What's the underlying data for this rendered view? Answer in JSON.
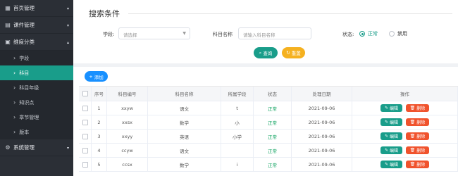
{
  "sidebar": {
    "groups": [
      {
        "label": "首页管理",
        "icon": "grid-icon",
        "caret": "▾"
      },
      {
        "label": "课件管理",
        "icon": "book-icon",
        "caret": "▾"
      },
      {
        "label": "维度分类",
        "icon": "doc-icon",
        "caret": "▴"
      },
      {
        "label": "系统管理",
        "icon": "gear-icon",
        "caret": "▾"
      }
    ],
    "sub_items": [
      {
        "label": "学段",
        "active": false
      },
      {
        "label": "科目",
        "active": true
      },
      {
        "label": "科目年级",
        "active": false
      },
      {
        "label": "知识点",
        "active": false
      },
      {
        "label": "章节管理",
        "active": false
      },
      {
        "label": "版本",
        "active": false
      }
    ]
  },
  "search": {
    "title": "搜索条件",
    "stage_label": "学段:",
    "stage_placeholder": "请选择",
    "subject_name_label": "科目名称",
    "subject_name_placeholder": "请输入科目名称",
    "status_label": "状态:",
    "status_normal": "正常",
    "status_disabled": "禁用",
    "query_button": "查询",
    "reset_button": "重置"
  },
  "toolbar": {
    "add_button": "添加"
  },
  "table": {
    "headers": [
      "序号",
      "科目编号",
      "科目名称",
      "所属学段",
      "状态",
      "处理日期",
      "操作"
    ],
    "rows": [
      {
        "index": "1",
        "code": "xxyw",
        "name": "语文",
        "stage": "t",
        "status": "正常",
        "date": "2021-09-06"
      },
      {
        "index": "2",
        "code": "xxsx",
        "name": "数学",
        "stage": "小",
        "status": "正常",
        "date": "2021-09-06"
      },
      {
        "index": "3",
        "code": "xxyy",
        "name": "英语",
        "stage": "小学",
        "status": "正常",
        "date": "2021-09-06"
      },
      {
        "index": "4",
        "code": "ccyw",
        "name": "语文",
        "stage": "",
        "status": "正常",
        "date": "2021-09-06"
      },
      {
        "index": "5",
        "code": "ccsx",
        "name": "数学",
        "stage": "i",
        "status": "正常",
        "date": "2021-09-06"
      }
    ],
    "edit_label": "编辑",
    "delete_label": "删除"
  },
  "colors": {
    "primary": "#199d8a",
    "warning": "#f5b120",
    "danger": "#f0532d",
    "blue": "#1890ff",
    "sidebar": "#2b2f36"
  }
}
